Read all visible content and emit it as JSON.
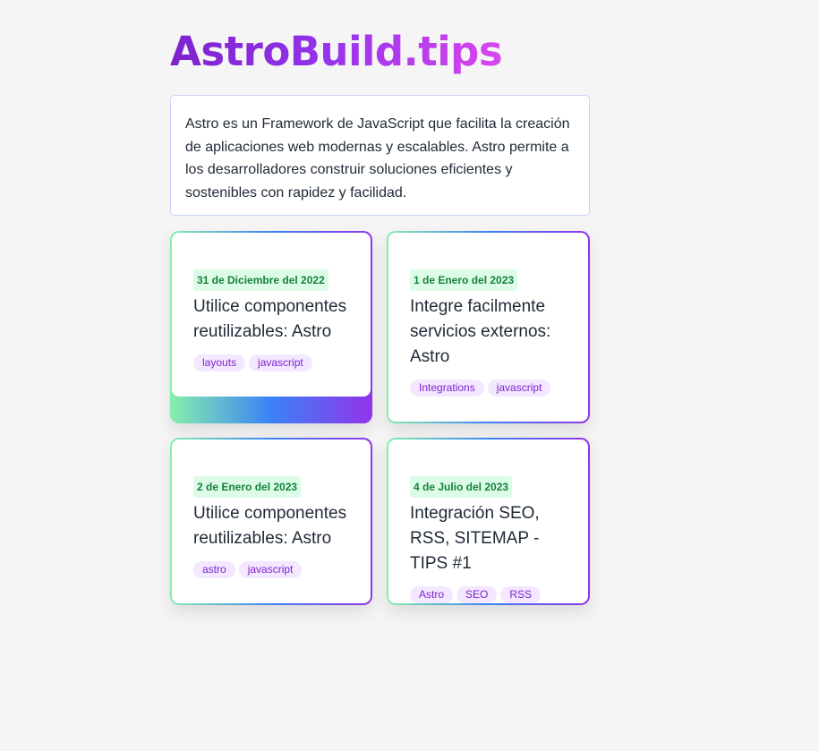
{
  "site": {
    "title": "AstroBuild.tips",
    "intro": "Astro es un Framework de JavaScript que facilita la creación de aplicaciones web modernas y escalables. Astro permite a los desarrolladores construir soluciones eficientes y sostenibles con rapidez y facilidad."
  },
  "colors": {
    "title_gradient": [
      "#7e22ce",
      "#d946ef"
    ],
    "card_border_gradient": [
      "#86efac",
      "#3b82f6",
      "#9333ea"
    ],
    "date_badge_bg": "#dcfce7",
    "date_badge_text": "#15803d",
    "tag_bg": "#f3e8ff",
    "tag_text": "#7e22ce"
  },
  "posts": [
    {
      "date": "31 de Diciembre del 2022",
      "title": "Utilice componentes reutilizables: Astro",
      "tags": [
        "layouts",
        "javascript"
      ],
      "state": "hovered"
    },
    {
      "date": "1 de Enero del 2023",
      "title": "Integre facilmente servicios externos: Astro",
      "tags": [
        "Integrations",
        "javascript"
      ]
    },
    {
      "date": "2 de Enero del 2023",
      "title": "Utilice componentes reutilizables: Astro",
      "tags": [
        "astro",
        "javascript"
      ]
    },
    {
      "date": "4 de Julio del 2023",
      "title": "Integración SEO, RSS, SITEMAP - TIPS #1",
      "tags": [
        "Astro",
        "SEO",
        "RSS"
      ]
    }
  ]
}
